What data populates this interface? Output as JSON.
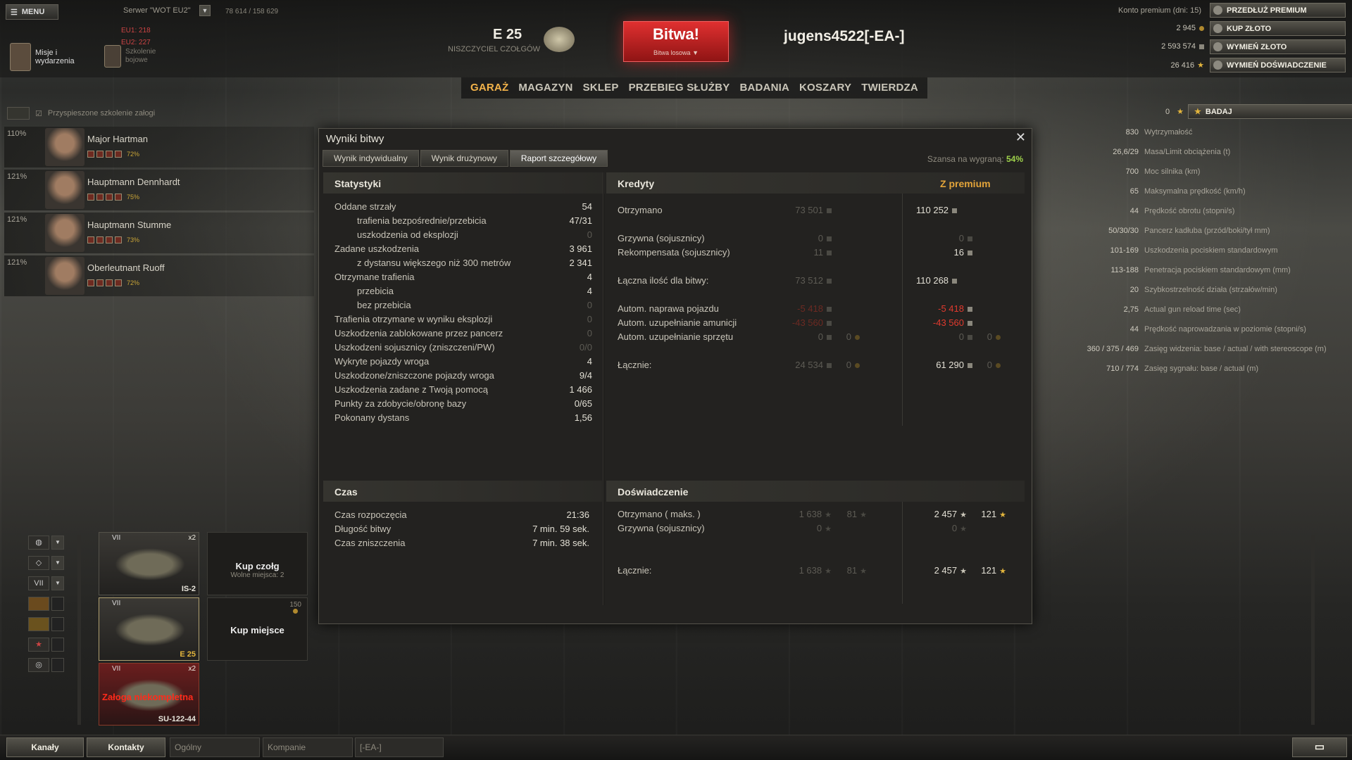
{
  "topbar": {
    "menu_label": "MENU",
    "server_label": "Serwer \"WOT EU2\"",
    "online": "78 614 / 158 629",
    "eu1": "EU1: 218",
    "eu2": "EU2: 227",
    "missions_label": "Misje i wydarzenia",
    "training_label": "Szkolenie bojowe",
    "tank_name": "E 25",
    "tank_class": "NISZCZYCIEL CZOŁGÓW",
    "battle_label": "Bitwa!",
    "battle_mode": "Bitwa losowa",
    "player": "jugens4522[-EA-]"
  },
  "nav": [
    "GARAŻ",
    "MAGAZYN",
    "SKLEP",
    "PRZEBIEG SŁUŻBY",
    "BADANIA",
    "KOSZARY",
    "TWIERDZA"
  ],
  "account": {
    "premium_text": "Konto premium (dni: 15)",
    "buttons": [
      "PRZEDŁUŻ PREMIUM",
      "KUP ZŁOTO",
      "WYMIEŃ ZŁOTO",
      "WYMIEŃ DOŚWIADCZENIE"
    ],
    "gold": "2 945",
    "credits": "2 593 574",
    "free_xp": "26 416",
    "tank_xp": "0",
    "research_label": "BADAJ"
  },
  "crew": {
    "header": "Przyspieszone szkolenie załogi",
    "members": [
      {
        "pct": "110%",
        "name": "Major Hartman",
        "skill": "72%"
      },
      {
        "pct": "121%",
        "name": "Hauptmann Dennhardt",
        "skill": "75%"
      },
      {
        "pct": "121%",
        "name": "Hauptmann Stumme",
        "skill": "73%"
      },
      {
        "pct": "121%",
        "name": "Oberleutnant Ruoff",
        "skill": "72%"
      }
    ]
  },
  "dialog": {
    "title": "Wyniki bitwy",
    "tabs": [
      "Wynik indywidualny",
      "Wynik drużynowy",
      "Raport szczegółowy"
    ],
    "win_label": "Szansa na wygraną:",
    "win_value": "54%",
    "stats_title": "Statystyki",
    "stats": [
      {
        "label": "Oddane strzały",
        "value": "54"
      },
      {
        "label": "trafienia bezpośrednie/przebicia",
        "value": "47/31"
      },
      {
        "label": "uszkodzenia od eksplozji",
        "value": "0"
      },
      {
        "label": "Zadane uszkodzenia",
        "value": "3 961"
      },
      {
        "label": "z dystansu większego niż 300 metrów",
        "value": "2 341"
      },
      {
        "label": "Otrzymane trafienia",
        "value": "4"
      },
      {
        "label": "przebicia",
        "value": "4"
      },
      {
        "label": "bez przebicia",
        "value": "0"
      },
      {
        "label": "Trafienia otrzymane w wyniku eksplozji",
        "value": "0"
      },
      {
        "label": "Uszkodzenia zablokowane przez pancerz",
        "value": "0"
      },
      {
        "label": "Uszkodzeni sojusznicy (zniszczeni/PW)",
        "value": "0/0"
      },
      {
        "label": "Wykryte pojazdy wroga",
        "value": "4"
      },
      {
        "label": "Uszkodzone/zniszczone pojazdy wroga",
        "value": "9/4"
      },
      {
        "label": "Uszkodzenia zadane z Twoją pomocą",
        "value": "1 466"
      },
      {
        "label": "Punkty za zdobycie/obronę bazy",
        "value": "0/65"
      },
      {
        "label": "Pokonany dystans",
        "value": "1,56"
      }
    ],
    "credits_title": "Kredyty",
    "premium_title": "Z premium",
    "credits": [
      {
        "label": "Otrzymano",
        "base": "73 501",
        "prem": "110 252"
      },
      {
        "label": "Grzywna (sojusznicy)",
        "base": "0",
        "prem": "0"
      },
      {
        "label": "Rekompensata (sojusznicy)",
        "base": "11",
        "prem": "16"
      },
      {
        "label": "Łączna ilość dla bitwy:",
        "base": "73 512",
        "prem": "110 268"
      },
      {
        "label": "Autom. naprawa pojazdu",
        "base": "-5 418",
        "prem": "-5 418"
      },
      {
        "label": "Autom. uzupełnianie amunicji",
        "base": "-43 560",
        "prem": "-43 560"
      },
      {
        "label": "Autom. uzupełnianie sprzętu",
        "base": "0",
        "base_gold": "0",
        "prem": "0",
        "prem_gold": "0"
      },
      {
        "label": "Łącznie:",
        "base": "24 534",
        "base_gold": "0",
        "prem": "61 290",
        "prem_gold": "0"
      }
    ],
    "time_title": "Czas",
    "time": [
      {
        "label": "Czas rozpoczęcia",
        "value": "21:36"
      },
      {
        "label": "Długość bitwy",
        "value": "7 min. 59 sek."
      },
      {
        "label": "Czas zniszczenia",
        "value": "7 min. 38 sek."
      }
    ],
    "xp_title": "Doświadczenie",
    "xp": [
      {
        "label": "Otrzymano ( maks. )",
        "base": "1 638",
        "base_free": "81",
        "prem": "2 457",
        "prem_free": "121"
      },
      {
        "label": "Grzywna (sojusznicy)",
        "base": "0",
        "prem": "0"
      },
      {
        "label": "Łącznie:",
        "base": "1 638",
        "base_free": "81",
        "prem": "2 457",
        "prem_free": "121"
      }
    ]
  },
  "vehicle_stats": [
    {
      "value": "830",
      "label": "Wytrzymałość"
    },
    {
      "value": "26,6/29",
      "label": "Masa/Limit obciążenia (t)"
    },
    {
      "value": "700",
      "label": "Moc silnika (km)"
    },
    {
      "value": "65",
      "label": "Maksymalna prędkość (km/h)"
    },
    {
      "value": "44",
      "label": "Prędkość obrotu (stopni/s)"
    },
    {
      "value": "50/30/30",
      "label": "Pancerz kadłuba (przód/boki/tył mm)"
    },
    {
      "value": "101-169",
      "label": "Uszkodzenia pociskiem standardowym"
    },
    {
      "value": "113-188",
      "label": "Penetracja pociskiem standardowym (mm)"
    },
    {
      "value": "20",
      "label": "Szybkostrzelność działa (strzałów/min)"
    },
    {
      "value": "2,75",
      "label": "Actual gun reload time (sec)"
    },
    {
      "value": "44",
      "label": "Prędkość naprowadzania w poziomie (stopni/s)"
    },
    {
      "value": "360 / 375 / 469",
      "label": "Zasięg widzenia: base / actual / with stereoscope (m)"
    },
    {
      "value": "710 / 774",
      "label": "Zasięg sygnału: base / actual (m)"
    }
  ],
  "filters": [
    "VII"
  ],
  "carousel": {
    "tanks": [
      {
        "tier": "VII",
        "name": "IS-2",
        "x2": "x2"
      },
      {
        "tier": "VII",
        "name": "E 25",
        "x2": ""
      },
      {
        "tier": "VII",
        "name": "SU-122-44",
        "x2": "x2",
        "warning": "Załoga niekompletna"
      }
    ],
    "buy_tank": "Kup czołg",
    "free_slots": "Wolne miejsca: 2",
    "buy_slot": "Kup miejsce",
    "slot_price": "150"
  },
  "bottom": {
    "channels": "Kanały",
    "contacts": "Kontakty",
    "tabs": [
      "Ogólny",
      "Kompanie",
      "[-EA-]"
    ]
  }
}
